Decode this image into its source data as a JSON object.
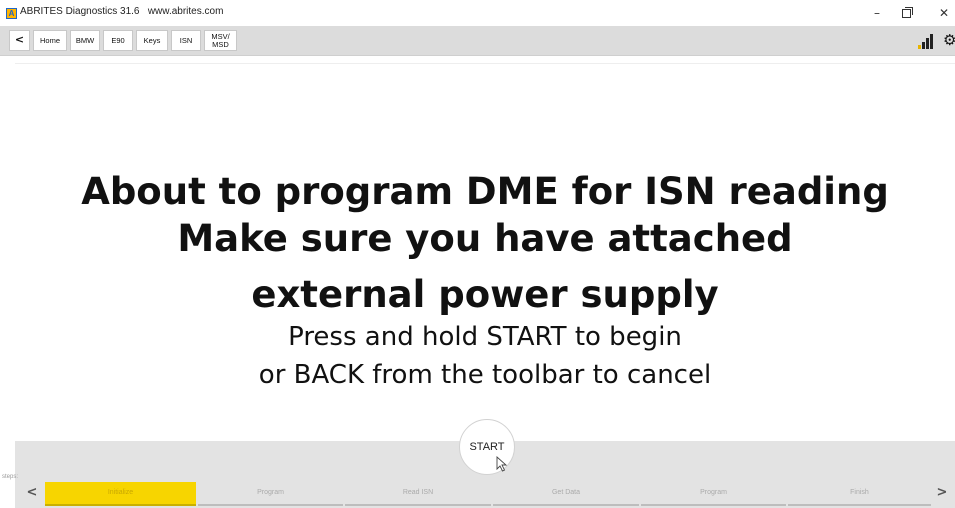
{
  "window": {
    "logo_letter": "A",
    "title": "ABRITES Diagnostics 31.6   www.abrites.com",
    "minimize_glyph": "–",
    "close_glyph": "✕"
  },
  "toolbar": {
    "back_glyph": "<",
    "buttons": [
      "Home",
      "BMW",
      "E90",
      "Keys",
      "ISN",
      "MSV/\nMSD"
    ],
    "signal_icon": "signal-strength-icon",
    "gear_glyph": "⚙"
  },
  "message": {
    "line1": "About to program DME for ISN reading",
    "line2": "Make sure you have attached",
    "line3": "external power supply",
    "line4": "Press and hold START to begin",
    "line5": "or BACK from the toolbar to cancel"
  },
  "start_button": {
    "label": "START"
  },
  "steps": {
    "label": "steps:",
    "prev_glyph": "<",
    "next_glyph": ">",
    "items": [
      "Initialize",
      "Program",
      "Read ISN",
      "Get Data",
      "Program",
      "Finish"
    ],
    "active_index": 0
  },
  "colors": {
    "active_step": "#f7d500",
    "toolbar_bg": "#dcdcdc",
    "steps_bg": "#e3e3e3"
  }
}
